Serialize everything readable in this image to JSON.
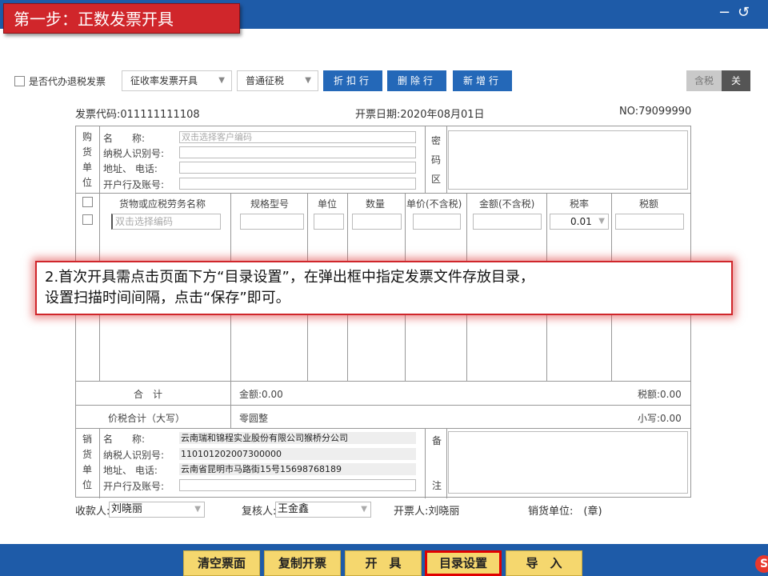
{
  "step_title": "第一步：正数发票开具",
  "window": {
    "minimize": "−",
    "back": "↺"
  },
  "toolbar": {
    "checkbox_label": "是否代办退税发票",
    "select1": "征收率发票开具",
    "select2": "普通征税",
    "btn_discount": "折扣行",
    "btn_delete": "删除行",
    "btn_add": "新增行",
    "toggle_tax": "含税",
    "toggle_off": "关"
  },
  "meta": {
    "code": "发票代码:011111111108",
    "date": "开票日期:2020年08月01日",
    "no": "NO:79099990"
  },
  "buyer": {
    "section_chars": [
      "购",
      "货",
      "单",
      "位"
    ],
    "name_label": "名　　称:",
    "name_placeholder": "双击选择客户编码",
    "tax_id_label": "纳税人识别号:",
    "address_label": "地址、 电话:",
    "bank_label": "开户行及账号:",
    "secret_chars": [
      "密",
      "码",
      "区"
    ]
  },
  "table": {
    "headers": [
      "货物或应税劳务名称",
      "规格型号",
      "单位",
      "数量",
      "单价(不含税)",
      "金额(不含税)",
      "税率",
      "税额"
    ],
    "row_placeholder": "双击选择编码",
    "tax_rate_value": "0.01"
  },
  "totals": {
    "sum_label": "合　计",
    "amount": "金额:0.00",
    "tax": "税额:0.00",
    "total_label": "价税合计（大写）",
    "total_upper": "零圆整",
    "total_lower": "小写:0.00"
  },
  "seller": {
    "section_chars": [
      "销",
      "货",
      "单",
      "位"
    ],
    "name_label": "名　　称:",
    "name_value": "云南瑞和锦程实业股份有限公司猴桥分公司",
    "tax_id_label": "纳税人识别号:",
    "tax_id_value": "110101202007300000",
    "address_label": "地址、 电话:",
    "address_value": "云南省昆明市马路街15号15698768189",
    "bank_label": "开户行及账号:",
    "remark_chars": [
      "备",
      "注"
    ]
  },
  "callout": {
    "line1": "2.首次开具需点击页面下方“目录设置”，在弹出框中指定发票文件存放目录，",
    "line2": "设置扫描时间间隔，点击“保存”即可。"
  },
  "footer": {
    "payee_label": "收款人:",
    "payee_value": "刘晓丽",
    "reviewer_label": "复核人:",
    "reviewer_value": "王金鑫",
    "drawer": "开票人:刘晓丽",
    "seller_unit": "销货单位:　(章)"
  },
  "bottom_buttons": {
    "clear": "清空票面",
    "copy": "复制开票",
    "issue": "开　具",
    "dir": "目录设置",
    "import": "导　入"
  },
  "logo": "S",
  "colors": {
    "accent_blue": "#1e5ba8",
    "title_red": "#d0262b",
    "button_yellow": "#f5d76e",
    "highlight": "#e00000"
  }
}
